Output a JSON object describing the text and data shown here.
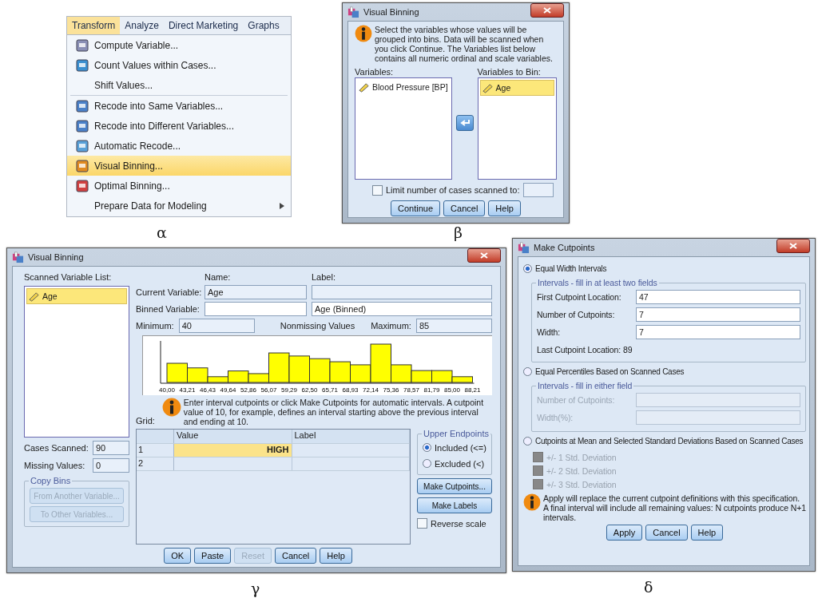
{
  "menu": {
    "caption": "α",
    "menubar": [
      {
        "label": "Transform",
        "selected": true
      },
      {
        "label": "Analyze",
        "selected": false
      },
      {
        "label": "Direct Marketing",
        "selected": false
      },
      {
        "label": "Graphs",
        "selected": false
      }
    ],
    "groups": [
      [
        {
          "label": "Compute Variable...",
          "has_icon": true,
          "selected": false,
          "submenu": false
        },
        {
          "label": "Count Values within Cases...",
          "has_icon": true,
          "selected": false,
          "submenu": false
        },
        {
          "label": "Shift Values...",
          "has_icon": false,
          "selected": false,
          "submenu": false
        }
      ],
      [
        {
          "label": "Recode into Same Variables...",
          "has_icon": true,
          "selected": false,
          "submenu": false
        },
        {
          "label": "Recode into Different Variables...",
          "has_icon": true,
          "selected": false,
          "submenu": false
        },
        {
          "label": "Automatic Recode...",
          "has_icon": true,
          "selected": false,
          "submenu": false
        },
        {
          "label": "Visual Binning...",
          "has_icon": true,
          "selected": true,
          "submenu": false
        },
        {
          "label": "Optimal Binning...",
          "has_icon": true,
          "selected": false,
          "submenu": false
        },
        {
          "label": "Prepare Data for Modeling",
          "has_icon": false,
          "selected": false,
          "submenu": true
        }
      ]
    ]
  },
  "select_dialog": {
    "caption": "β",
    "title": "Visual Binning",
    "info": "Select the variables whose values will be grouped into bins. Data will be scanned when you click Continue. The Variables list below contains all numeric ordinal and scale variables.",
    "variables_label": "Variables:",
    "variables": [
      {
        "label": "Blood Pressure [BP]",
        "selected": false
      }
    ],
    "bin_label": "Variables to Bin:",
    "bin_variables": [
      {
        "label": "Age",
        "selected": true
      }
    ],
    "limit": {
      "label": "Limit number of cases scanned to:",
      "checked": false
    },
    "buttons": [
      "Continue",
      "Cancel",
      "Help"
    ]
  },
  "binning_dialog": {
    "caption": "γ",
    "title": "Visual Binning",
    "scanned_label": "Scanned Variable List:",
    "scanned": [
      {
        "label": "Age",
        "selected": true
      }
    ],
    "name_heading": "Name:",
    "label_heading": "Label:",
    "current": {
      "label": "Current Variable:",
      "name": "Age"
    },
    "binned": {
      "label": "Binned Variable:",
      "var_label": "Age (Binned)"
    },
    "minimum": {
      "label": "Minimum:",
      "value": "40"
    },
    "nonmissing": "Nonmissing Values",
    "maximum": {
      "label": "Maximum:",
      "value": "85"
    },
    "histogram_edges": [
      "40,00",
      "43,21",
      "46,43",
      "49,64",
      "52,86",
      "56,07",
      "59,29",
      "62,50",
      "65,71",
      "68,93",
      "72,14",
      "75,36",
      "78,57",
      "81,79",
      "85,00",
      "88,21"
    ],
    "info": "Enter interval cutpoints or click Make Cutpoints for automatic intervals. A cutpoint value of 10, for example, defines an interval starting above the previous interval and ending at 10.",
    "grid_label": "Grid:",
    "grid_columns": [
      "Value",
      "Label"
    ],
    "grid_rows": [
      {
        "number": "1",
        "value": "HIGH",
        "selected": true
      },
      {
        "number": "2",
        "selected": false
      }
    ],
    "cases_scanned": {
      "label": "Cases Scanned:",
      "value": "90"
    },
    "missing": {
      "label": "Missing Values:",
      "value": "0"
    },
    "copy_bins": {
      "title": "Copy Bins",
      "buttons": [
        {
          "label": "From Another Variable...",
          "disabled": true
        },
        {
          "label": "To Other Variables...",
          "disabled": true
        }
      ]
    },
    "upper_endpoints": {
      "title": "Upper Endpoints",
      "options": [
        {
          "label": "Included (<=)",
          "selected": true
        },
        {
          "label": "Excluded (<)",
          "selected": false
        }
      ]
    },
    "side_buttons": [
      "Make Cutpoints...",
      "Make Labels"
    ],
    "reverse": {
      "label": "Reverse scale",
      "checked": false
    },
    "buttons": [
      {
        "label": "OK",
        "disabled": false
      },
      {
        "label": "Paste",
        "disabled": false
      },
      {
        "label": "Reset",
        "disabled": true
      },
      {
        "label": "Cancel",
        "disabled": false
      },
      {
        "label": "Help",
        "disabled": false
      }
    ]
  },
  "cutpoints_dialog": {
    "caption": "δ",
    "title": "Make Cutpoints",
    "sections": [
      {
        "kind": "fields",
        "label": "Equal Width Intervals",
        "selected": true,
        "disabled": false,
        "group_title": "Intervals - fill in at least two fields",
        "fields": [
          {
            "label": "First Cutpoint Location:",
            "value": "47"
          },
          {
            "label": "Number of Cutpoints:",
            "value": "7"
          },
          {
            "label": "Width:",
            "value": "7"
          }
        ],
        "note": "Last Cutpoint Location: 89"
      },
      {
        "kind": "fields",
        "label": "Equal Percentiles Based on Scanned Cases",
        "selected": false,
        "disabled": true,
        "group_title": "Intervals - fill in either field",
        "fields": [
          {
            "label": "Number of Cutpoints:"
          },
          {
            "label": "Width(%):"
          }
        ]
      },
      {
        "kind": "checks",
        "label": "Cutpoints at Mean and Selected Standard Deviations Based on Scanned Cases",
        "selected": false,
        "disabled": true,
        "checks": [
          {
            "label": "+/- 1 Std. Deviation",
            "checked": false
          },
          {
            "label": "+/- 2 Std. Deviation",
            "checked": false
          },
          {
            "label": "+/- 3 Std. Deviation",
            "checked": false
          }
        ]
      }
    ],
    "info": "Apply will replace the current cutpoint definitions with this specification. A final interval will include all remaining values: N cutpoints produce N+1 intervals.",
    "buttons": [
      "Apply",
      "Cancel",
      "Help"
    ]
  }
}
